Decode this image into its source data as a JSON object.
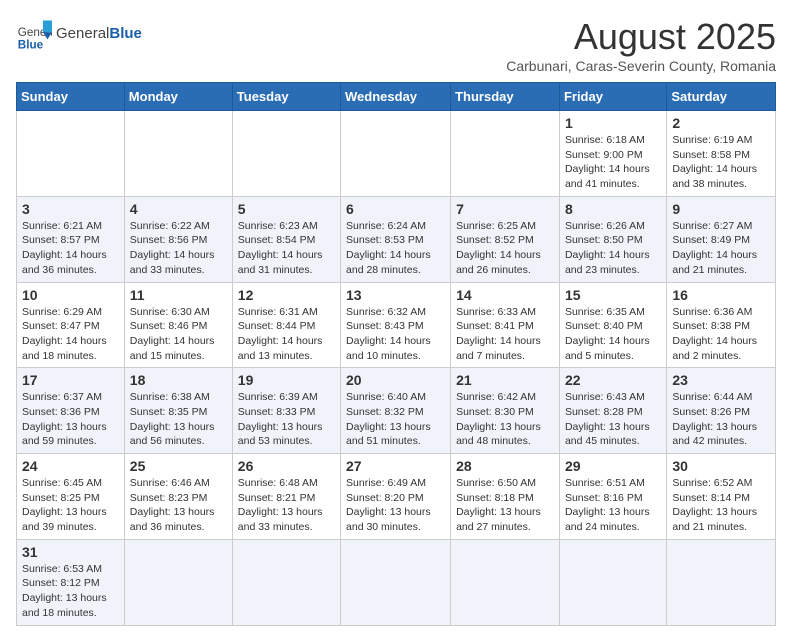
{
  "header": {
    "logo_text_general": "General",
    "logo_text_blue": "Blue",
    "month_year": "August 2025",
    "location": "Carbunari, Caras-Severin County, Romania"
  },
  "days_of_week": [
    "Sunday",
    "Monday",
    "Tuesday",
    "Wednesday",
    "Thursday",
    "Friday",
    "Saturday"
  ],
  "weeks": [
    [
      {
        "day": "",
        "info": ""
      },
      {
        "day": "",
        "info": ""
      },
      {
        "day": "",
        "info": ""
      },
      {
        "day": "",
        "info": ""
      },
      {
        "day": "",
        "info": ""
      },
      {
        "day": "1",
        "info": "Sunrise: 6:18 AM\nSunset: 9:00 PM\nDaylight: 14 hours and 41 minutes."
      },
      {
        "day": "2",
        "info": "Sunrise: 6:19 AM\nSunset: 8:58 PM\nDaylight: 14 hours and 38 minutes."
      }
    ],
    [
      {
        "day": "3",
        "info": "Sunrise: 6:21 AM\nSunset: 8:57 PM\nDaylight: 14 hours and 36 minutes."
      },
      {
        "day": "4",
        "info": "Sunrise: 6:22 AM\nSunset: 8:56 PM\nDaylight: 14 hours and 33 minutes."
      },
      {
        "day": "5",
        "info": "Sunrise: 6:23 AM\nSunset: 8:54 PM\nDaylight: 14 hours and 31 minutes."
      },
      {
        "day": "6",
        "info": "Sunrise: 6:24 AM\nSunset: 8:53 PM\nDaylight: 14 hours and 28 minutes."
      },
      {
        "day": "7",
        "info": "Sunrise: 6:25 AM\nSunset: 8:52 PM\nDaylight: 14 hours and 26 minutes."
      },
      {
        "day": "8",
        "info": "Sunrise: 6:26 AM\nSunset: 8:50 PM\nDaylight: 14 hours and 23 minutes."
      },
      {
        "day": "9",
        "info": "Sunrise: 6:27 AM\nSunset: 8:49 PM\nDaylight: 14 hours and 21 minutes."
      }
    ],
    [
      {
        "day": "10",
        "info": "Sunrise: 6:29 AM\nSunset: 8:47 PM\nDaylight: 14 hours and 18 minutes."
      },
      {
        "day": "11",
        "info": "Sunrise: 6:30 AM\nSunset: 8:46 PM\nDaylight: 14 hours and 15 minutes."
      },
      {
        "day": "12",
        "info": "Sunrise: 6:31 AM\nSunset: 8:44 PM\nDaylight: 14 hours and 13 minutes."
      },
      {
        "day": "13",
        "info": "Sunrise: 6:32 AM\nSunset: 8:43 PM\nDaylight: 14 hours and 10 minutes."
      },
      {
        "day": "14",
        "info": "Sunrise: 6:33 AM\nSunset: 8:41 PM\nDaylight: 14 hours and 7 minutes."
      },
      {
        "day": "15",
        "info": "Sunrise: 6:35 AM\nSunset: 8:40 PM\nDaylight: 14 hours and 5 minutes."
      },
      {
        "day": "16",
        "info": "Sunrise: 6:36 AM\nSunset: 8:38 PM\nDaylight: 14 hours and 2 minutes."
      }
    ],
    [
      {
        "day": "17",
        "info": "Sunrise: 6:37 AM\nSunset: 8:36 PM\nDaylight: 13 hours and 59 minutes."
      },
      {
        "day": "18",
        "info": "Sunrise: 6:38 AM\nSunset: 8:35 PM\nDaylight: 13 hours and 56 minutes."
      },
      {
        "day": "19",
        "info": "Sunrise: 6:39 AM\nSunset: 8:33 PM\nDaylight: 13 hours and 53 minutes."
      },
      {
        "day": "20",
        "info": "Sunrise: 6:40 AM\nSunset: 8:32 PM\nDaylight: 13 hours and 51 minutes."
      },
      {
        "day": "21",
        "info": "Sunrise: 6:42 AM\nSunset: 8:30 PM\nDaylight: 13 hours and 48 minutes."
      },
      {
        "day": "22",
        "info": "Sunrise: 6:43 AM\nSunset: 8:28 PM\nDaylight: 13 hours and 45 minutes."
      },
      {
        "day": "23",
        "info": "Sunrise: 6:44 AM\nSunset: 8:26 PM\nDaylight: 13 hours and 42 minutes."
      }
    ],
    [
      {
        "day": "24",
        "info": "Sunrise: 6:45 AM\nSunset: 8:25 PM\nDaylight: 13 hours and 39 minutes."
      },
      {
        "day": "25",
        "info": "Sunrise: 6:46 AM\nSunset: 8:23 PM\nDaylight: 13 hours and 36 minutes."
      },
      {
        "day": "26",
        "info": "Sunrise: 6:48 AM\nSunset: 8:21 PM\nDaylight: 13 hours and 33 minutes."
      },
      {
        "day": "27",
        "info": "Sunrise: 6:49 AM\nSunset: 8:20 PM\nDaylight: 13 hours and 30 minutes."
      },
      {
        "day": "28",
        "info": "Sunrise: 6:50 AM\nSunset: 8:18 PM\nDaylight: 13 hours and 27 minutes."
      },
      {
        "day": "29",
        "info": "Sunrise: 6:51 AM\nSunset: 8:16 PM\nDaylight: 13 hours and 24 minutes."
      },
      {
        "day": "30",
        "info": "Sunrise: 6:52 AM\nSunset: 8:14 PM\nDaylight: 13 hours and 21 minutes."
      }
    ],
    [
      {
        "day": "31",
        "info": "Sunrise: 6:53 AM\nSunset: 8:12 PM\nDaylight: 13 hours and 18 minutes."
      },
      {
        "day": "",
        "info": ""
      },
      {
        "day": "",
        "info": ""
      },
      {
        "day": "",
        "info": ""
      },
      {
        "day": "",
        "info": ""
      },
      {
        "day": "",
        "info": ""
      },
      {
        "day": "",
        "info": ""
      }
    ]
  ]
}
